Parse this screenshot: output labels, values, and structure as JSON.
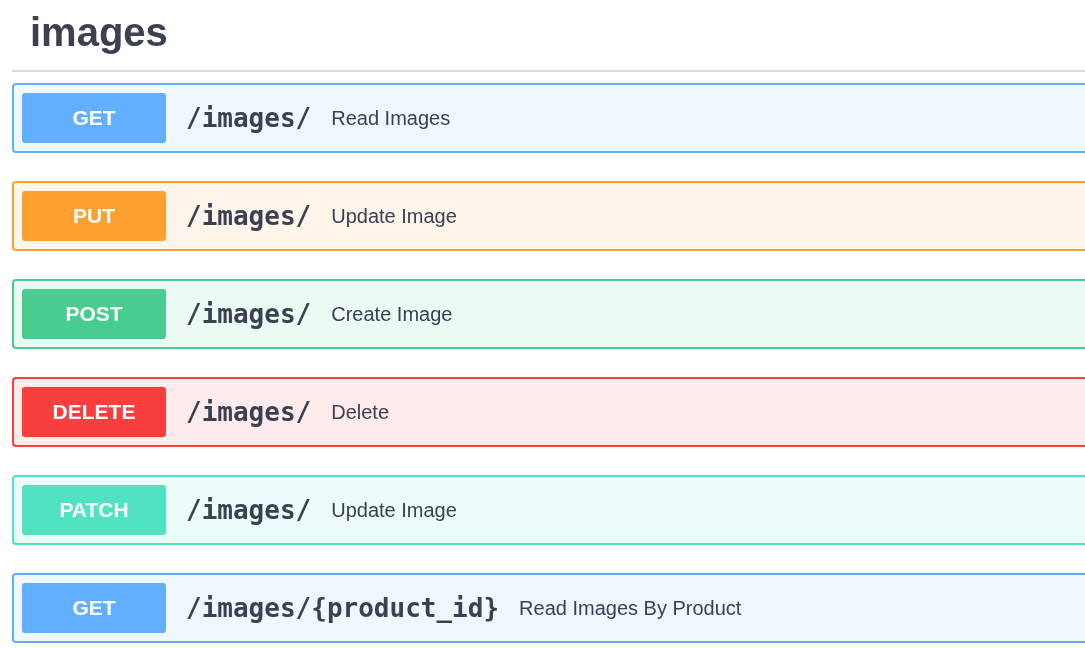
{
  "section": {
    "title": "images"
  },
  "operations": [
    {
      "method": "GET",
      "path": "/images/",
      "summary": "Read Images",
      "color": "#61affe"
    },
    {
      "method": "PUT",
      "path": "/images/",
      "summary": "Update Image",
      "color": "#fca130"
    },
    {
      "method": "POST",
      "path": "/images/",
      "summary": "Create Image",
      "color": "#49cc90"
    },
    {
      "method": "DELETE",
      "path": "/images/",
      "summary": "Delete",
      "color": "#f93e3e"
    },
    {
      "method": "PATCH",
      "path": "/images/",
      "summary": "Update Image",
      "color": "#50e3c2"
    },
    {
      "method": "GET",
      "path": "/images/{product_id}",
      "summary": "Read Images By Product",
      "color": "#61affe"
    }
  ]
}
